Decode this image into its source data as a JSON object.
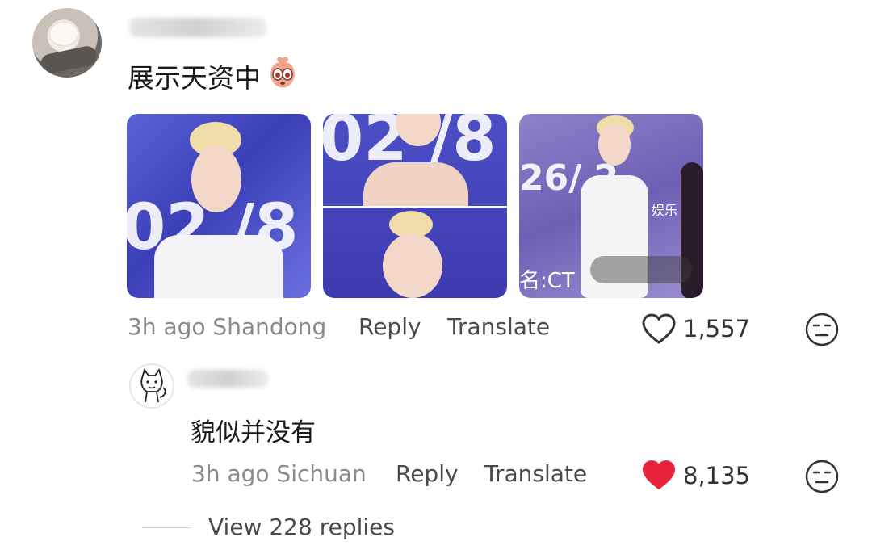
{
  "comments": [
    {
      "text": "展示天资中",
      "emoji": "peach-face-emoji",
      "meta": "3h ago Shandong",
      "reply_label": "Reply",
      "translate_label": "Translate",
      "likes": "1,557",
      "liked": false
    },
    {
      "text": "貌似并没有",
      "meta": "3h ago Sichuan",
      "reply_label": "Reply",
      "translate_label": "Translate",
      "likes": "8,135",
      "liked": true
    }
  ],
  "thumbnails": {
    "t1": {
      "big_text": "02 /8"
    },
    "t2": {
      "big_text": "02 /8"
    },
    "t3": {
      "big_text": "26/ 2-",
      "overlay_text": "名:CT",
      "tag_text": "娱乐"
    }
  },
  "view_replies": "View 228 replies",
  "colors": {
    "like_red": "#e8243c",
    "meta_gray": "#8a8a8a",
    "action_gray": "#4a4a4a"
  }
}
